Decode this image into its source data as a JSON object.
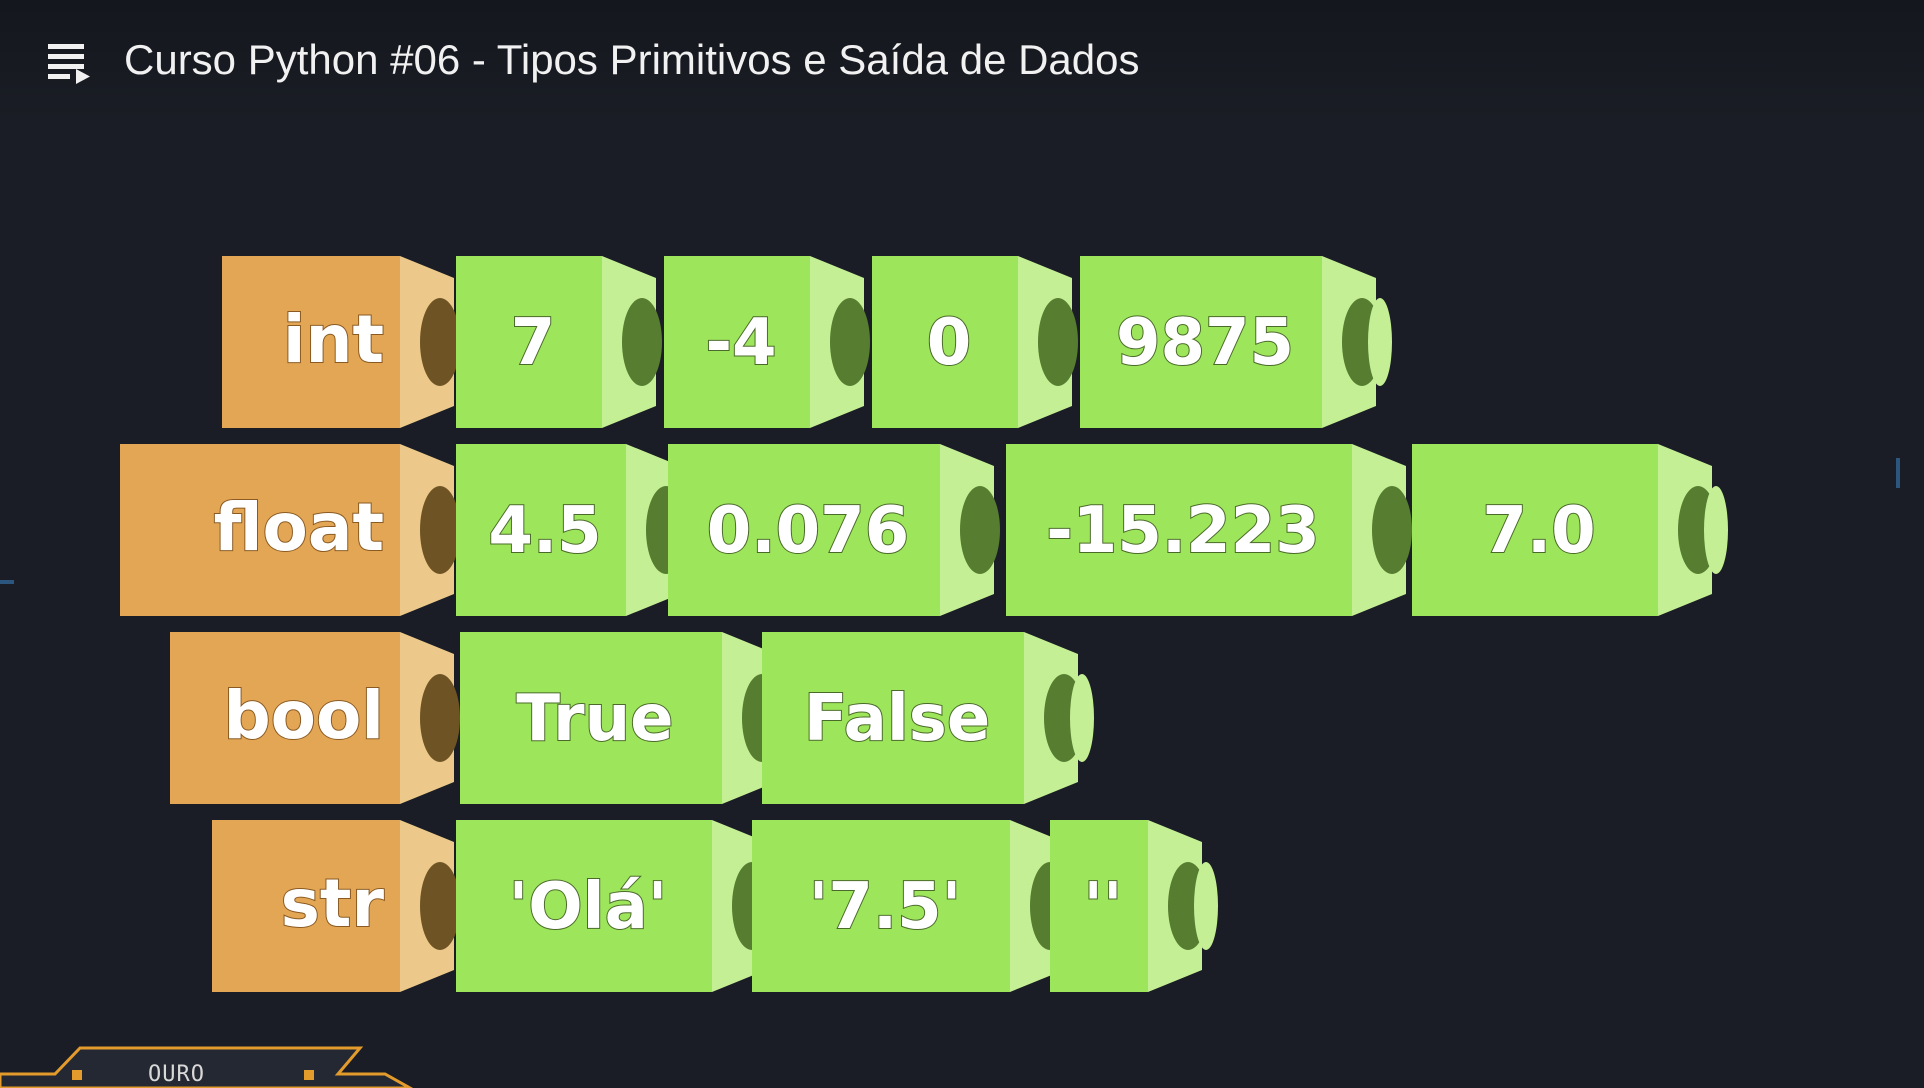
{
  "header": {
    "title": "Curso Python #06 - Tipos Primitivos e Saída de Dados",
    "playlist_icon": "playlist-icon"
  },
  "rows": [
    {
      "type": "int",
      "values": [
        "7",
        "-4",
        "0",
        "9875"
      ]
    },
    {
      "type": "float",
      "values": [
        "4.5",
        "0.076",
        "-15.223",
        "7.0"
      ]
    },
    {
      "type": "bool",
      "values": [
        "True",
        "False"
      ]
    },
    {
      "type": "str",
      "values": [
        "'Olá'",
        "'7.5'",
        "''"
      ]
    }
  ],
  "badge": {
    "label": "OURO"
  },
  "colors": {
    "background": "#1a1d25",
    "type_block": "#e2a654",
    "type_side": "#ecc98a",
    "value_block": "#9de55b",
    "value_side": "#c5ef95",
    "connector": "#567d30",
    "type_connector": "#6e5424",
    "accent": "#e39c2c"
  }
}
